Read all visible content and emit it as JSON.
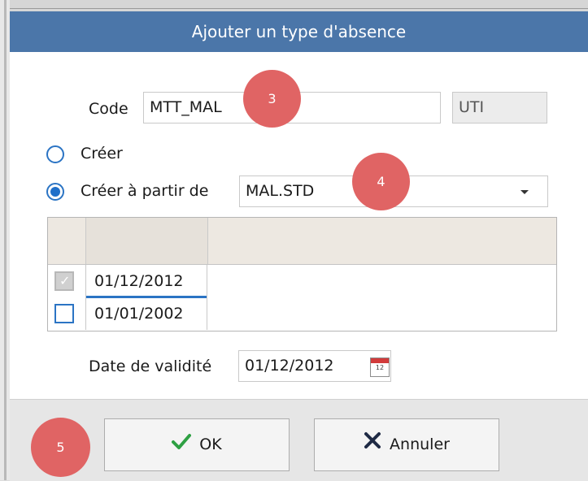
{
  "dialog": {
    "title": "Ajouter un type d'absence"
  },
  "form": {
    "code_label": "Code",
    "code_value": "MTT_MAL",
    "code_suffix_value": "UTI",
    "radio_create_label": "Créer",
    "radio_create_from_label": "Créer à partir de",
    "radio_selected": "create_from",
    "source_select_value": "MAL.STD",
    "validity_label": "Date de validité",
    "validity_value": "01/12/2012",
    "calendar_day": "12"
  },
  "grid": {
    "rows": [
      {
        "date": "01/12/2012",
        "checked": true
      },
      {
        "date": "01/01/2002",
        "checked": false
      }
    ]
  },
  "buttons": {
    "ok_label": "OK",
    "cancel_label": "Annuler"
  },
  "annotations": {
    "badge_3": "3",
    "badge_4": "4",
    "badge_5": "5",
    "badge_color": "#e06464"
  },
  "colors": {
    "title_bar": "#4b76a9",
    "radio_accent": "#1f6fc9",
    "ok_check": "#2ea043",
    "cancel_x": "#1f2a44"
  },
  "icons": {
    "ok": "checkmark-icon",
    "cancel": "x-icon",
    "date_picker": "calendar-icon",
    "select": "chevron-down-icon"
  }
}
